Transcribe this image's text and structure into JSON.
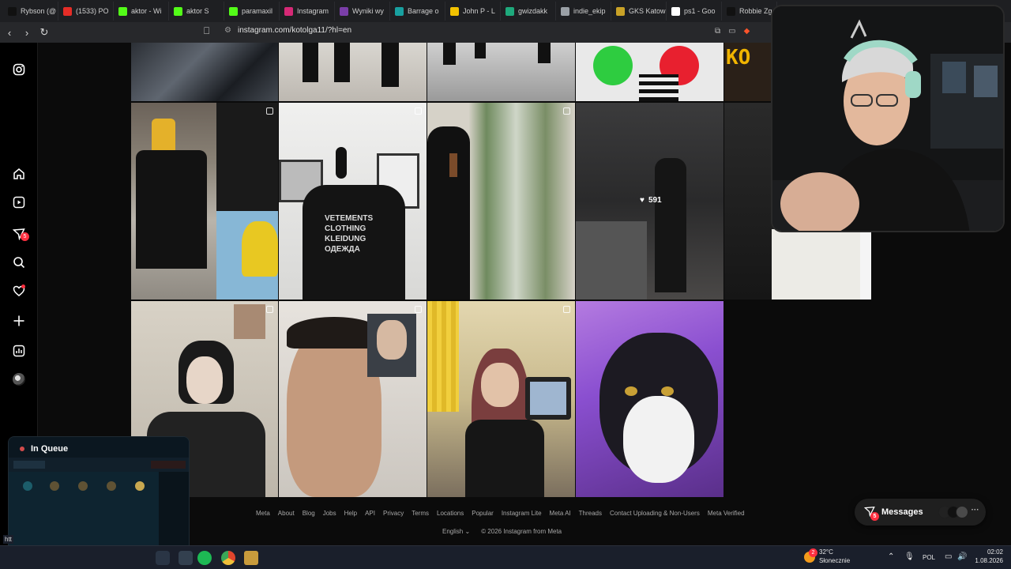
{
  "browser": {
    "tabs": [
      {
        "label": "Rybson (@",
        "icon": "tiktok-icon",
        "color": "#111111"
      },
      {
        "label": "(1533) PO",
        "icon": "youtube-icon",
        "color": "#e52d27"
      },
      {
        "label": "aktor - Wi",
        "icon": "kick-icon",
        "color": "#53fc18"
      },
      {
        "label": "aktor S",
        "icon": "kick-icon",
        "color": "#53fc18"
      },
      {
        "label": "paramaxil",
        "icon": "kick-icon",
        "color": "#53fc18"
      },
      {
        "label": "Instagram",
        "icon": "instagram-icon",
        "color": "#d62976"
      },
      {
        "label": "Wyniki wy",
        "icon": "puzzle-icon",
        "color": "#7a3ea8"
      },
      {
        "label": "Barrage o",
        "icon": "refresh-icon",
        "color": "#18a0a0"
      },
      {
        "label": "John P - L",
        "icon": "letter-icon",
        "color": "#f2c200"
      },
      {
        "label": "gwizdakk",
        "icon": "tt-icon",
        "color": "#1ea97c"
      },
      {
        "label": "indie_ekip",
        "icon": "globe-icon",
        "color": "#9aa0a6"
      },
      {
        "label": "GKS Katow",
        "icon": "shield-icon",
        "color": "#c9a227"
      },
      {
        "label": "ps1 - Goo",
        "icon": "google-icon",
        "color": "#ffffff"
      },
      {
        "label": "Robbie Zg",
        "icon": "tiktok-icon",
        "color": "#111111"
      }
    ],
    "url": "instagram.com/kotolga11/?hl=en"
  },
  "grid": {
    "likes_count": "591"
  },
  "footer": {
    "links": [
      "Meta",
      "About",
      "Blog",
      "Jobs",
      "Help",
      "API",
      "Privacy",
      "Terms",
      "Locations",
      "Popular",
      "Instagram Lite",
      "Meta AI",
      "Threads",
      "Contact Uploading & Non-Users",
      "Meta Verified"
    ],
    "language": "English",
    "copyright": "© 2026 Instagram from Meta"
  },
  "messages": {
    "label": "Messages",
    "badge": "5"
  },
  "rail": {
    "messages_badge": "5"
  },
  "queue": {
    "title": "In Queue"
  },
  "taskbar": {
    "weather_temp": "32°C",
    "weather_desc": "Słonecznie",
    "weather_badge": "2",
    "language": "POL",
    "time": "02:02",
    "date": "1.08.2026",
    "left_text": "htt"
  },
  "colors": {
    "background": "#0b0b0b",
    "badge": "#ff3040",
    "tab_bar": "#1e1f22",
    "taskbar": "#1a1f2b"
  }
}
